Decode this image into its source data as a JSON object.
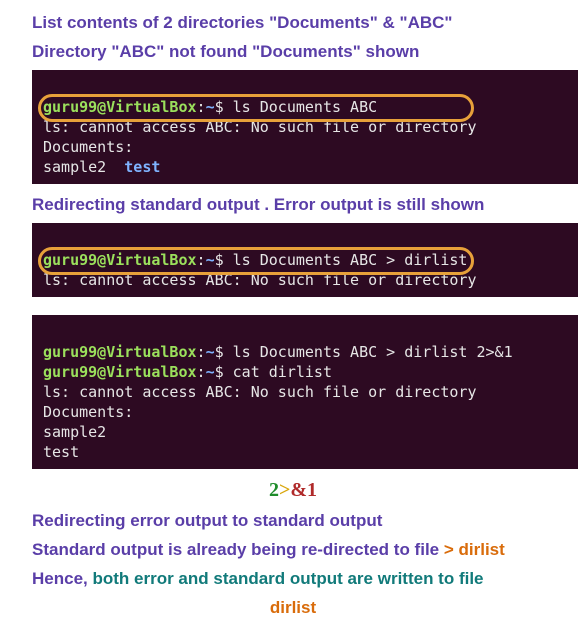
{
  "annotations": {
    "a1_line1": "List contents of 2 directories \"Documents\" & \"ABC\"",
    "a2_line1": "Directory \"ABC\" not found \"Documents\" shown",
    "a3_line1": "Redirecting standard output . Error output is still shown",
    "a4_line1": "Redirecting error output to standard output",
    "a5_prefix": "Standard output is already being re-directed to file ",
    "a5_redir": "> dirlist",
    "a6_prefix": "Hence, ",
    "a6_mid": "both error and standard output are written to file",
    "a6_file": "dirlist"
  },
  "spec": {
    "two": "2",
    "gt": ">",
    "amp": "&",
    "one": "1"
  },
  "prompt": {
    "user_host": "guru99@VirtualBox",
    "colon": ":",
    "tilde": "~",
    "dollar": "$"
  },
  "terminal1": {
    "cmd": "ls Documents ABC",
    "error": "ls: cannot access ABC: No such file or directory",
    "docs_header": "Documents:",
    "file1": "sample2",
    "file2": "test"
  },
  "terminal2": {
    "cmd": "ls Documents ABC > dirlist",
    "error": "ls: cannot access ABC: No such file or directory"
  },
  "terminal3": {
    "cmd1": "ls Documents ABC > dirlist 2>&1",
    "cmd2": "cat dirlist",
    "out_error": "ls: cannot access ABC: No such file or directory",
    "out_docs": "Documents:",
    "out_f1": "sample2",
    "out_f2": "test"
  }
}
